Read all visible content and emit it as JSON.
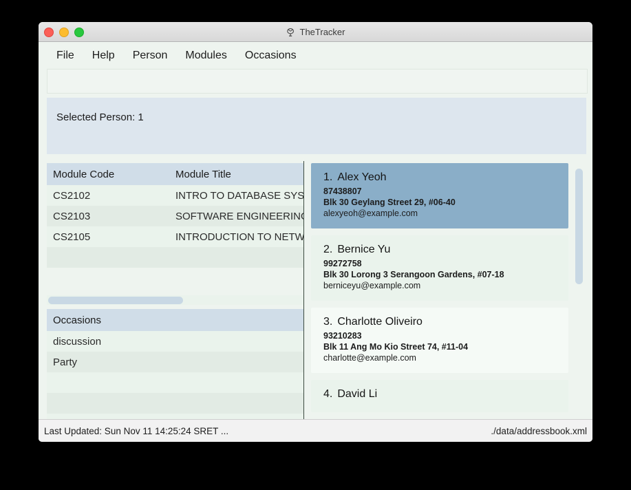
{
  "window": {
    "title": "TheTracker",
    "title_icon": "app-icon",
    "controls": {
      "close": "close",
      "minimize": "minimize",
      "maximize": "maximize"
    }
  },
  "menubar": {
    "items": [
      {
        "label": "File"
      },
      {
        "label": "Help"
      },
      {
        "label": "Person"
      },
      {
        "label": "Modules"
      },
      {
        "label": "Occasions"
      }
    ]
  },
  "banner": {
    "selected_person": "Selected Person: 1"
  },
  "modules_table": {
    "headers": [
      "Module Code",
      "Module Title"
    ],
    "rows": [
      {
        "code": "CS2102",
        "title": "INTRO TO DATABASE SYSTEMS"
      },
      {
        "code": "CS2103",
        "title": "SOFTWARE ENGINEERING"
      },
      {
        "code": "CS2105",
        "title": "INTRODUCTION TO NETWORKS"
      },
      {
        "code": "",
        "title": ""
      }
    ]
  },
  "occasions_table": {
    "headers": [
      "Occasions",
      ""
    ],
    "rows": [
      {
        "name": "discussion",
        "extra": ""
      },
      {
        "name": "Party",
        "extra": ""
      },
      {
        "name": "",
        "extra": ""
      },
      {
        "name": "",
        "extra": ""
      },
      {
        "name": "",
        "extra": ""
      }
    ]
  },
  "person_list": [
    {
      "index": "1.",
      "name": "Alex Yeoh",
      "phone": "87438807",
      "address": "Blk 30 Geylang Street 29, #06-40",
      "email": "alexyeoh@example.com",
      "selected": true
    },
    {
      "index": "2.",
      "name": "Bernice Yu",
      "phone": "99272758",
      "address": "Blk 30 Lorong 3 Serangoon Gardens, #07-18",
      "email": "berniceyu@example.com",
      "selected": false
    },
    {
      "index": "3.",
      "name": "Charlotte Oliveiro",
      "phone": "93210283",
      "address": "Blk 11 Ang Mo Kio Street 74, #11-04",
      "email": "charlotte@example.com",
      "selected": false
    },
    {
      "index": "4.",
      "name": "David Li",
      "phone": "",
      "address": "",
      "email": "",
      "selected": false
    }
  ],
  "statusbar": {
    "last_updated": "Last Updated: Sun Nov 11 14:25:24 SRET ...",
    "file_path": "./data/addressbook.xml"
  },
  "colors": {
    "accent_selected": "#8aaec8",
    "header_blue": "#d0dde8",
    "banner_blue": "#dde6ee",
    "panel_green": "#eef4ef",
    "row_odd": "#eaf3ec",
    "row_even": "#e2ebe4",
    "scrollbar_thumb": "#c8d8e4"
  }
}
